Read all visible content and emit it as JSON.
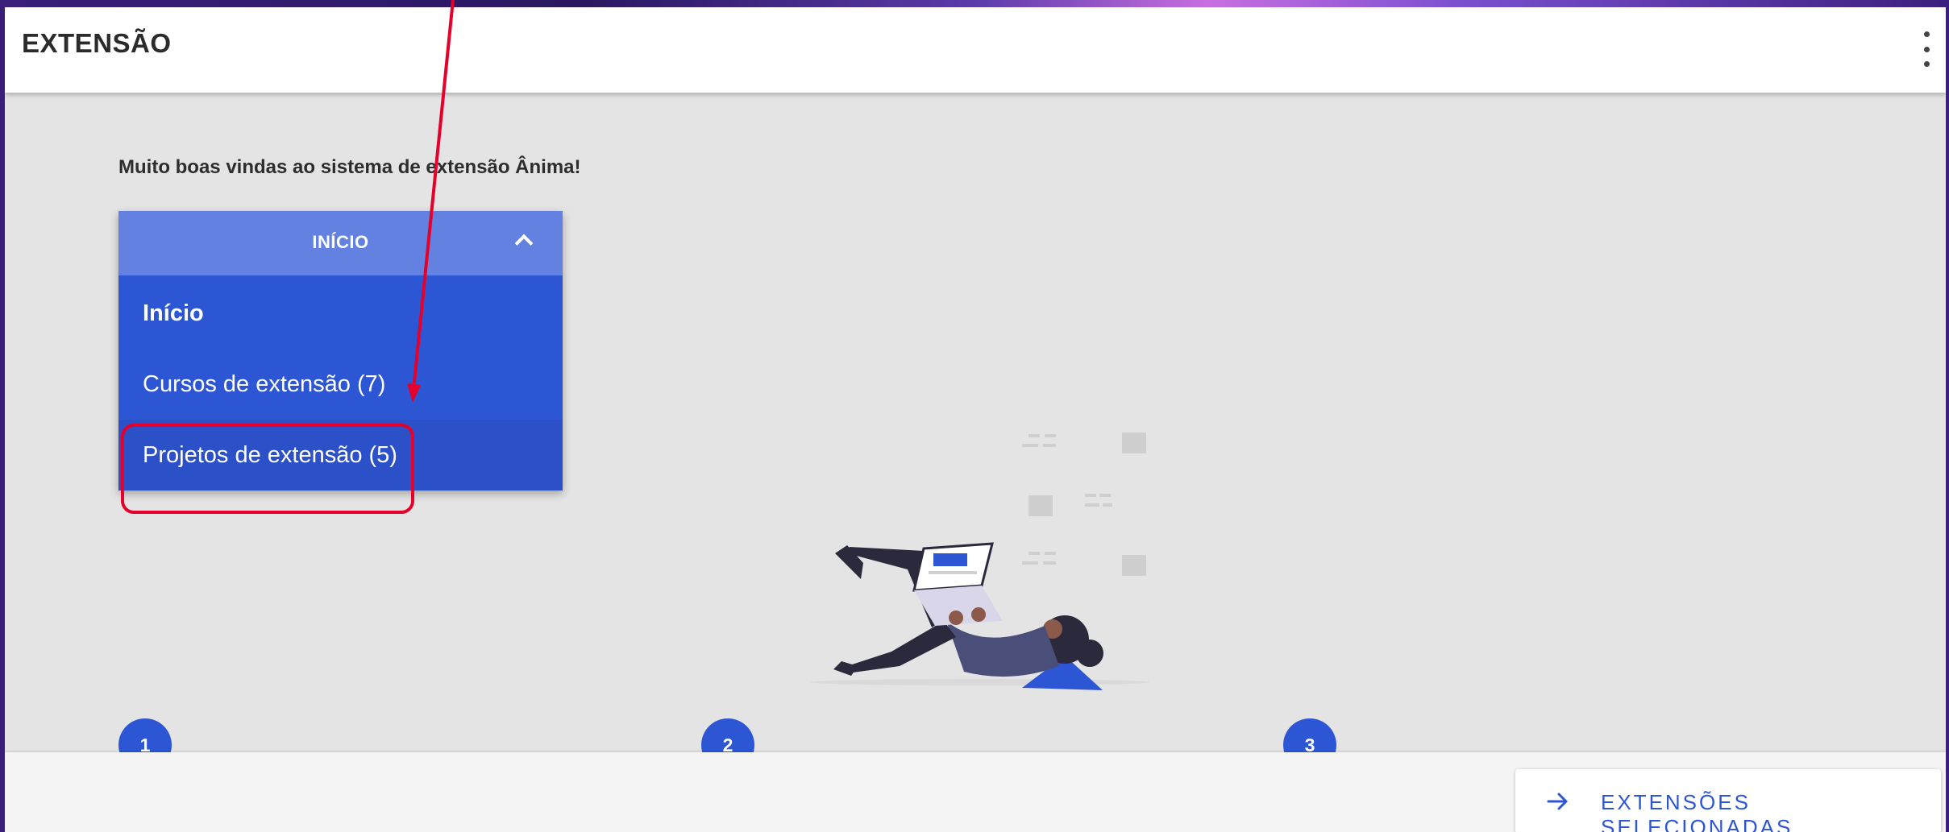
{
  "app": {
    "title": "EXTENSÃO",
    "menu_icon": "more-vertical-icon"
  },
  "main": {
    "welcome_text": "Muito boas vindas ao sistema de extensão Ânima!"
  },
  "dropdown": {
    "selected_label": "INÍCIO",
    "chevron_icon": "chevron-up-icon",
    "options": [
      {
        "label": "Início"
      },
      {
        "label": "Cursos de extensão (7)"
      },
      {
        "label": "Projetos de extensão (5)"
      }
    ]
  },
  "steps": [
    "1",
    "2",
    "3"
  ],
  "footer": {
    "button_label": "EXTENSÕES SELECIONADAS",
    "button_icon": "arrow-right-icon"
  },
  "colors": {
    "primary": "#2d56d4",
    "dropdown_header": "#6381e0",
    "annotation": "#e4002b",
    "page_background": "#e4e4e4"
  }
}
